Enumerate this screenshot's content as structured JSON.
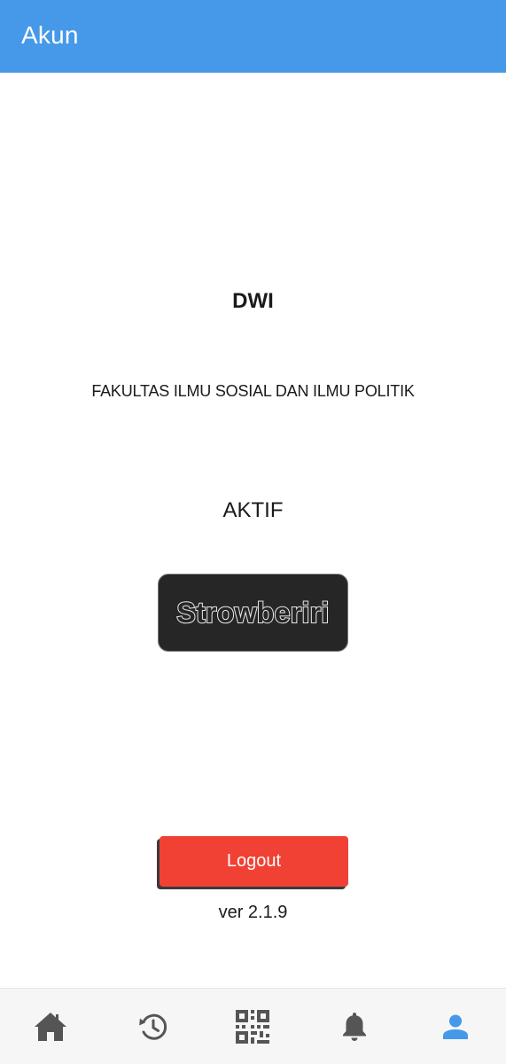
{
  "header": {
    "title": "Akun"
  },
  "profile": {
    "name": "DWI",
    "faculty": "FAKULTAS ILMU SOSIAL DAN ILMU POLITIK",
    "status": "AKTIF",
    "badge_label": "Strowberiri"
  },
  "actions": {
    "logout_label": "Logout"
  },
  "footer": {
    "version": "ver 2.1.9"
  },
  "bottom_nav": {
    "items": [
      {
        "icon": "home-icon",
        "active": false
      },
      {
        "icon": "history-icon",
        "active": false
      },
      {
        "icon": "qr-code-icon",
        "active": false
      },
      {
        "icon": "bell-icon",
        "active": false
      },
      {
        "icon": "user-icon",
        "active": true
      }
    ]
  },
  "colors": {
    "header": "#4699e8",
    "logout": "#f04134",
    "nav_inactive": "#555555",
    "nav_active": "#4699e8",
    "badge_bg": "#262626"
  }
}
